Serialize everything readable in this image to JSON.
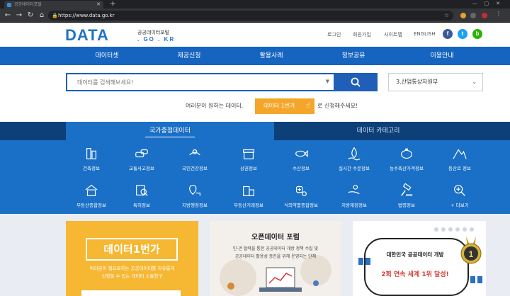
{
  "browser": {
    "tab_title": "공공데이터포털",
    "url": "https://www.data.go.kr"
  },
  "header": {
    "logo_main": "DATA",
    "logo_sub": "공공데이터포털",
    "logo_domain": ". GO . KR",
    "util_links": [
      "로그인",
      "회원가입",
      "사이트맵",
      "ENGLISH"
    ],
    "sns": [
      "facebook-icon",
      "twitter-icon",
      "blog-icon"
    ],
    "colors": {
      "brand": "#1f73c8",
      "nav": "#1564c0",
      "panel": "#1a6fc6",
      "accent": "#f4a62a"
    }
  },
  "nav": {
    "items": [
      "데이터셋",
      "제공신청",
      "활용사례",
      "정보공유",
      "이용안내"
    ]
  },
  "search": {
    "placeholder": "데이터를 검색해보세요!",
    "org_selected": "3.산업통상자원부",
    "request_prefix": "여러분이 원하는 데이터,",
    "request_button": "데이터 1번가",
    "request_suffix": "로 신청해주세요!"
  },
  "categories": {
    "tabs": [
      "국가중점데이터",
      "데이터 카테고리"
    ],
    "items": [
      {
        "label": "건축정보",
        "icon": "building-icon"
      },
      {
        "label": "교통사고정보",
        "icon": "car-crash-icon"
      },
      {
        "label": "국민건강정보",
        "icon": "health-hands-icon"
      },
      {
        "label": "상권정보",
        "icon": "store-icon"
      },
      {
        "label": "수산정보",
        "icon": "fish-icon"
      },
      {
        "label": "실시간 수문정보",
        "icon": "water-drop-icon"
      },
      {
        "label": "농수축산가격정보",
        "icon": "piggy-bank-icon"
      },
      {
        "label": "등산로 정보",
        "icon": "mountain-icon"
      },
      {
        "label": "부동산종합정보",
        "icon": "house-icon"
      },
      {
        "label": "특허정보",
        "icon": "patent-magnifier-icon"
      },
      {
        "label": "지방행정정보",
        "icon": "map-pin-icon"
      },
      {
        "label": "부동산거래정보",
        "icon": "real-estate-icon"
      },
      {
        "label": "식의약품종합정보",
        "icon": "medicine-icon"
      },
      {
        "label": "지방재정정보",
        "icon": "hand-coin-icon"
      },
      {
        "label": "법령정보",
        "icon": "gavel-icon"
      },
      {
        "label": "+ 더보기",
        "icon": "more-search-icon"
      }
    ]
  },
  "cards": {
    "card1_title": "데이터1번가",
    "card1_desc": [
      "여러분이 필요로하는 공공데이터를 자유롭게",
      "신청할 수 있는 데이터 소통창구"
    ],
    "card2_title": "오픈데이터 포럼",
    "card2_desc": [
      "민·관 협력을 통한 공공데이터 개방 정책 수립 및",
      "공공데이터 활용성 증진을 위해 운영되는 단체"
    ],
    "card3_line1": "대한민국 공공데이터 개방",
    "card3_line2": "2회 연속 세계 1위 달성!"
  }
}
